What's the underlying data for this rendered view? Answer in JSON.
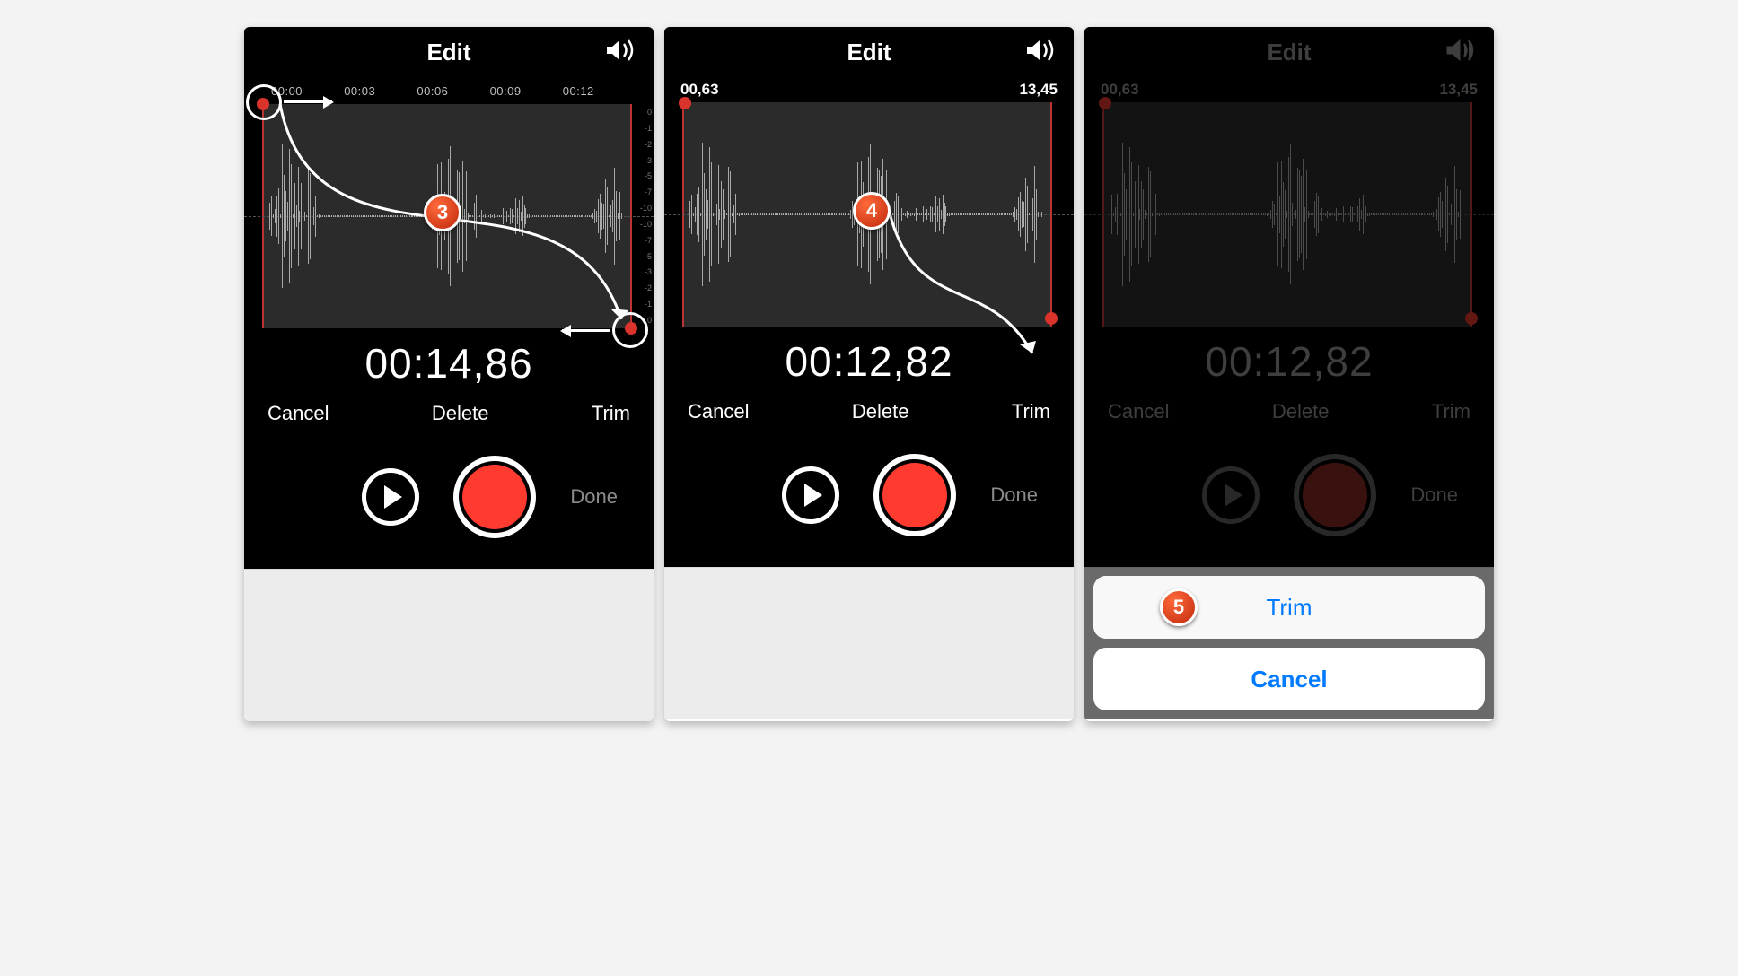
{
  "panels": [
    {
      "title": "Edit",
      "ticks": [
        "00:00",
        "00:03",
        "00:06",
        "00:09",
        "00:12"
      ],
      "time_start": null,
      "time_end": null,
      "big_time": "00:14,86",
      "cancel": "Cancel",
      "delete": "Delete",
      "trim": "Trim",
      "done": "Done",
      "step": "3",
      "db_scale": [
        "0",
        "-1",
        "-2",
        "-3",
        "-5",
        "-7",
        "-10",
        "-10",
        "-7",
        "-5",
        "-3",
        "-2",
        "-1",
        "0"
      ]
    },
    {
      "title": "Edit",
      "time_start": "00,63",
      "time_end": "13,45",
      "big_time": "00:12,82",
      "cancel": "Cancel",
      "delete": "Delete",
      "trim": "Trim",
      "done": "Done",
      "step": "4"
    },
    {
      "title": "Edit",
      "time_start": "00,63",
      "time_end": "13,45",
      "big_time": "00:12,82",
      "cancel": "Cancel",
      "delete": "Delete",
      "trim": "Trim",
      "done": "Done",
      "step": "5",
      "sheet_trim": "Trim",
      "sheet_cancel": "Cancel"
    }
  ]
}
